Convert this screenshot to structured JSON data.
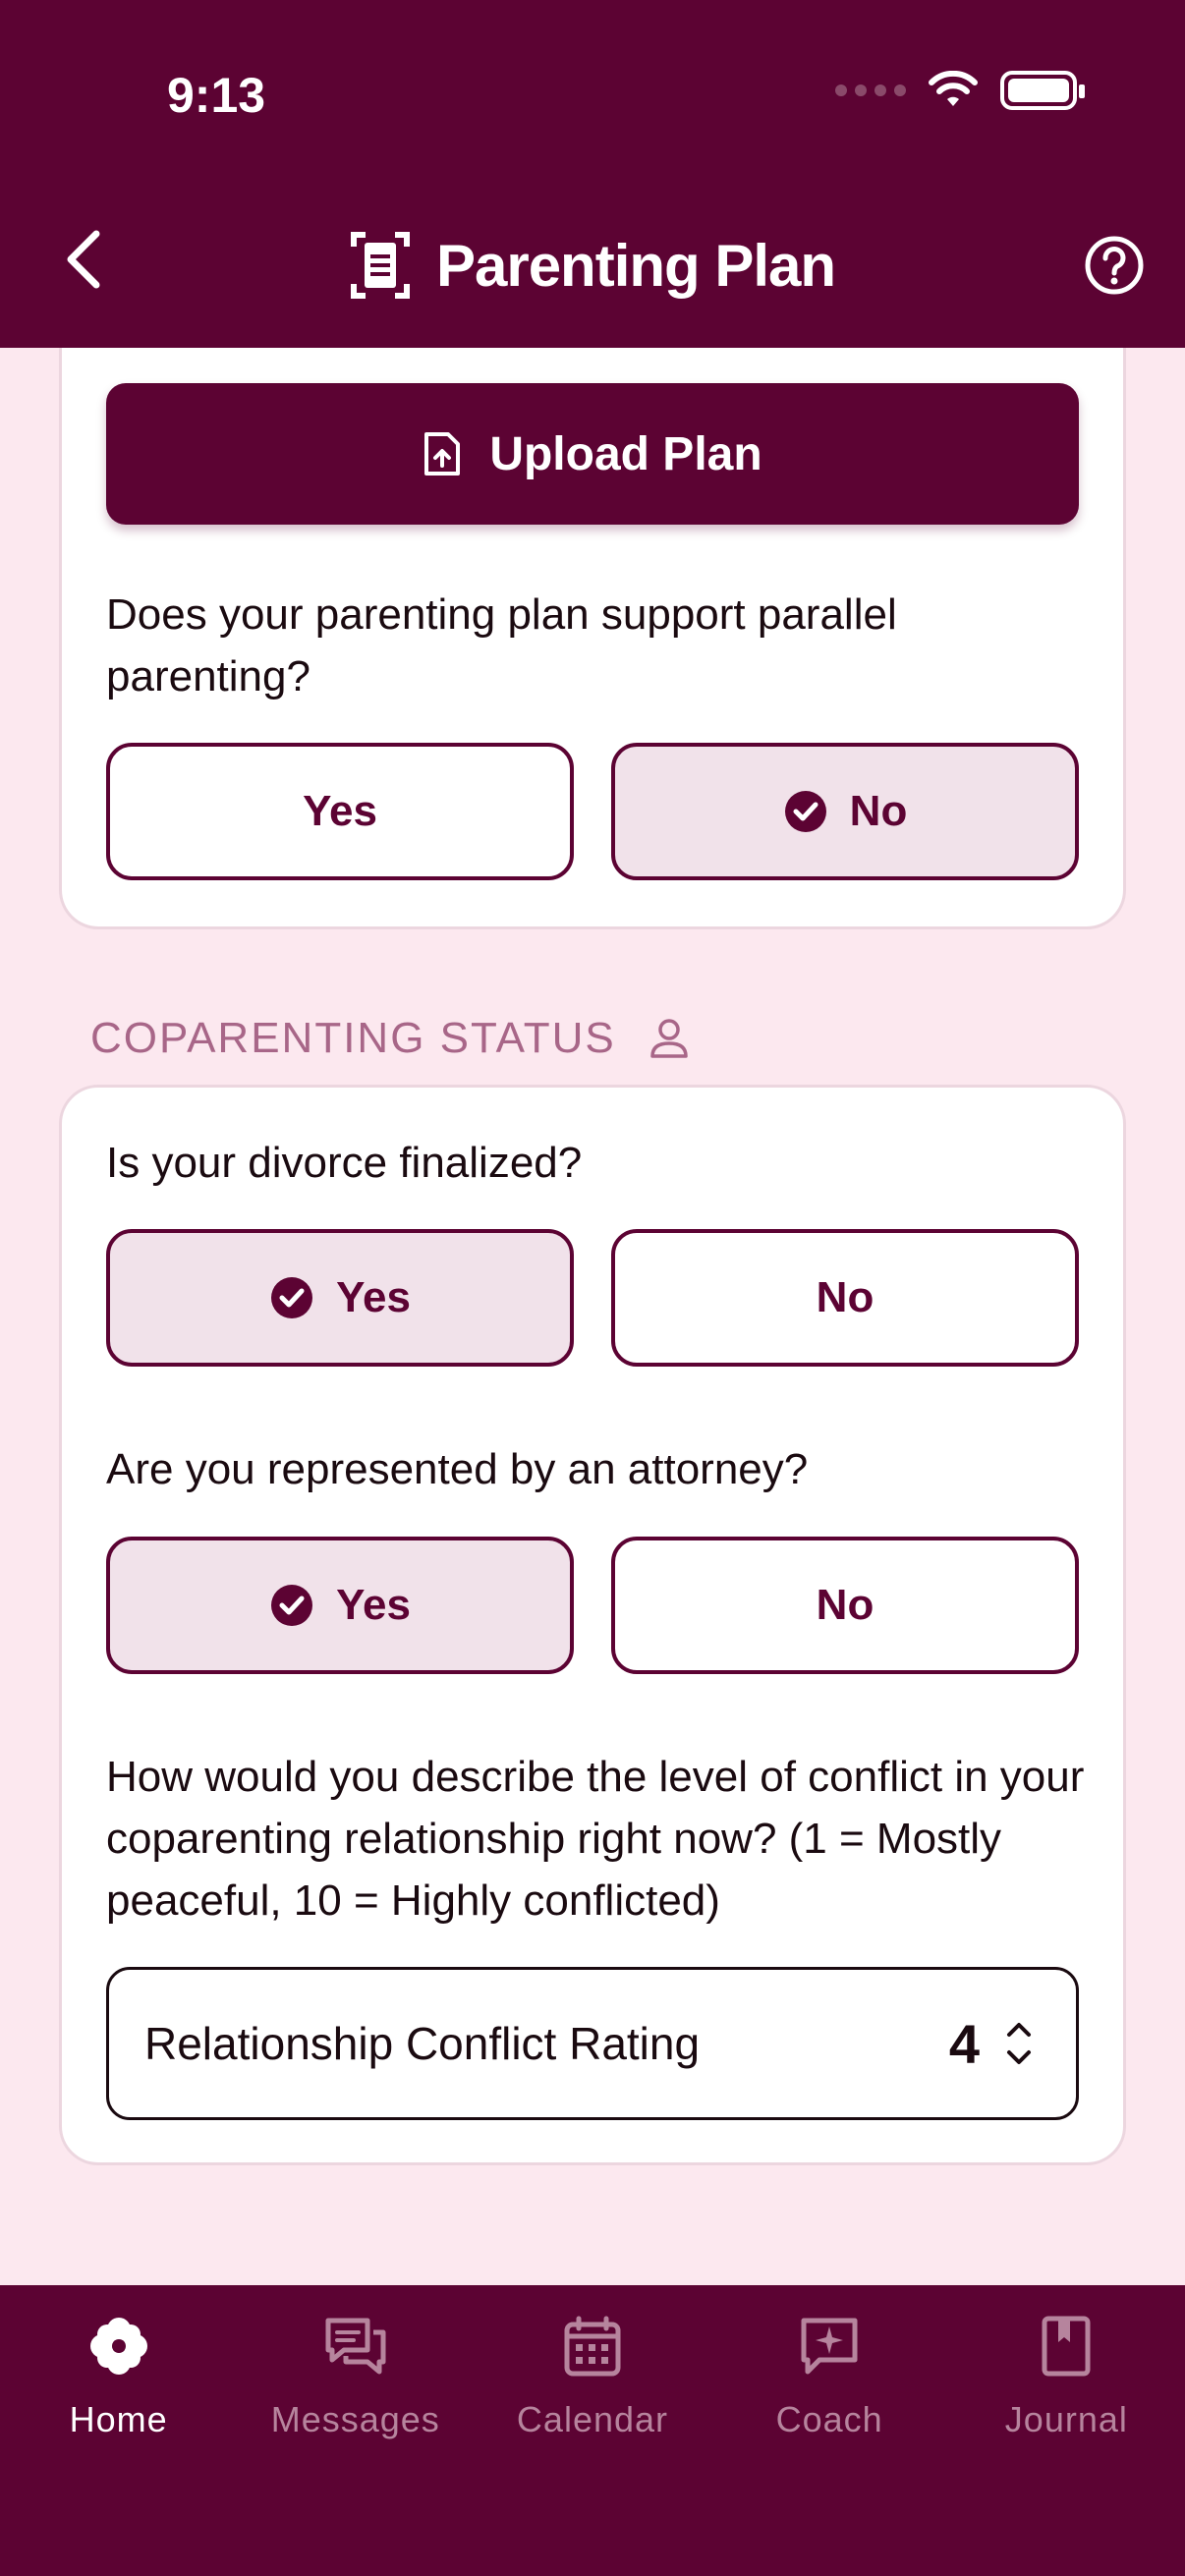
{
  "status_bar": {
    "time": "9:13"
  },
  "header": {
    "title": "Parenting Plan"
  },
  "plan_card": {
    "upload_label": "Upload Plan",
    "parallel_question": "Does your parenting plan support parallel parenting?",
    "parallel_options": [
      {
        "label": "Yes",
        "selected": false
      },
      {
        "label": "No",
        "selected": true
      }
    ]
  },
  "coparenting_status": {
    "section_title": "COPARENTING STATUS",
    "divorce_question": "Is your divorce finalized?",
    "divorce_options": [
      {
        "label": "Yes",
        "selected": true
      },
      {
        "label": "No",
        "selected": false
      }
    ],
    "attorney_question": "Are you represented by an attorney?",
    "attorney_options": [
      {
        "label": "Yes",
        "selected": true
      },
      {
        "label": "No",
        "selected": false
      }
    ],
    "conflict_question": "How would you describe the level of conflict in your coparenting relationship right now? (1 = Mostly peaceful, 10 = Highly conflicted)",
    "rating_label": "Relationship Conflict Rating",
    "rating_value": "4"
  },
  "tabbar": {
    "tabs": [
      {
        "label": "Home",
        "icon": "flower-icon",
        "active": true
      },
      {
        "label": "Messages",
        "icon": "messages-icon",
        "active": false
      },
      {
        "label": "Calendar",
        "icon": "calendar-icon",
        "active": false
      },
      {
        "label": "Coach",
        "icon": "coach-icon",
        "active": false
      },
      {
        "label": "Journal",
        "icon": "journal-icon",
        "active": false
      }
    ]
  },
  "colors": {
    "brand": "#5c0333",
    "background": "#fce8ef",
    "selected_fill": "#f1e2ea",
    "muted_section": "#a86688"
  }
}
